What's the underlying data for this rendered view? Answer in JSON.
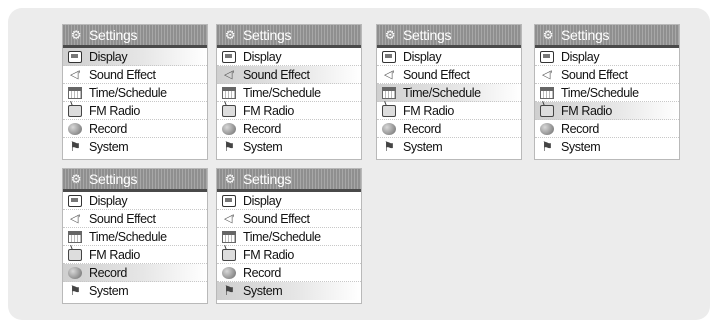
{
  "header_title": "Settings",
  "menu": [
    {
      "label": "Display",
      "icon": "display-icon"
    },
    {
      "label": "Sound Effect",
      "icon": "sound-effect-icon"
    },
    {
      "label": "Time/Schedule",
      "icon": "time-schedule-icon"
    },
    {
      "label": "FM Radio",
      "icon": "fm-radio-icon"
    },
    {
      "label": "Record",
      "icon": "record-icon"
    },
    {
      "label": "System",
      "icon": "system-icon"
    }
  ],
  "screens": [
    {
      "selected": 0
    },
    {
      "selected": 1
    },
    {
      "selected": 2
    },
    {
      "selected": 3
    },
    {
      "selected": 4
    },
    {
      "selected": 5
    }
  ],
  "colors": {
    "panel": "#ececec",
    "header": "#9a9a9a",
    "header_separator": "#4a4a4a",
    "highlight": "#d6d6d6"
  }
}
